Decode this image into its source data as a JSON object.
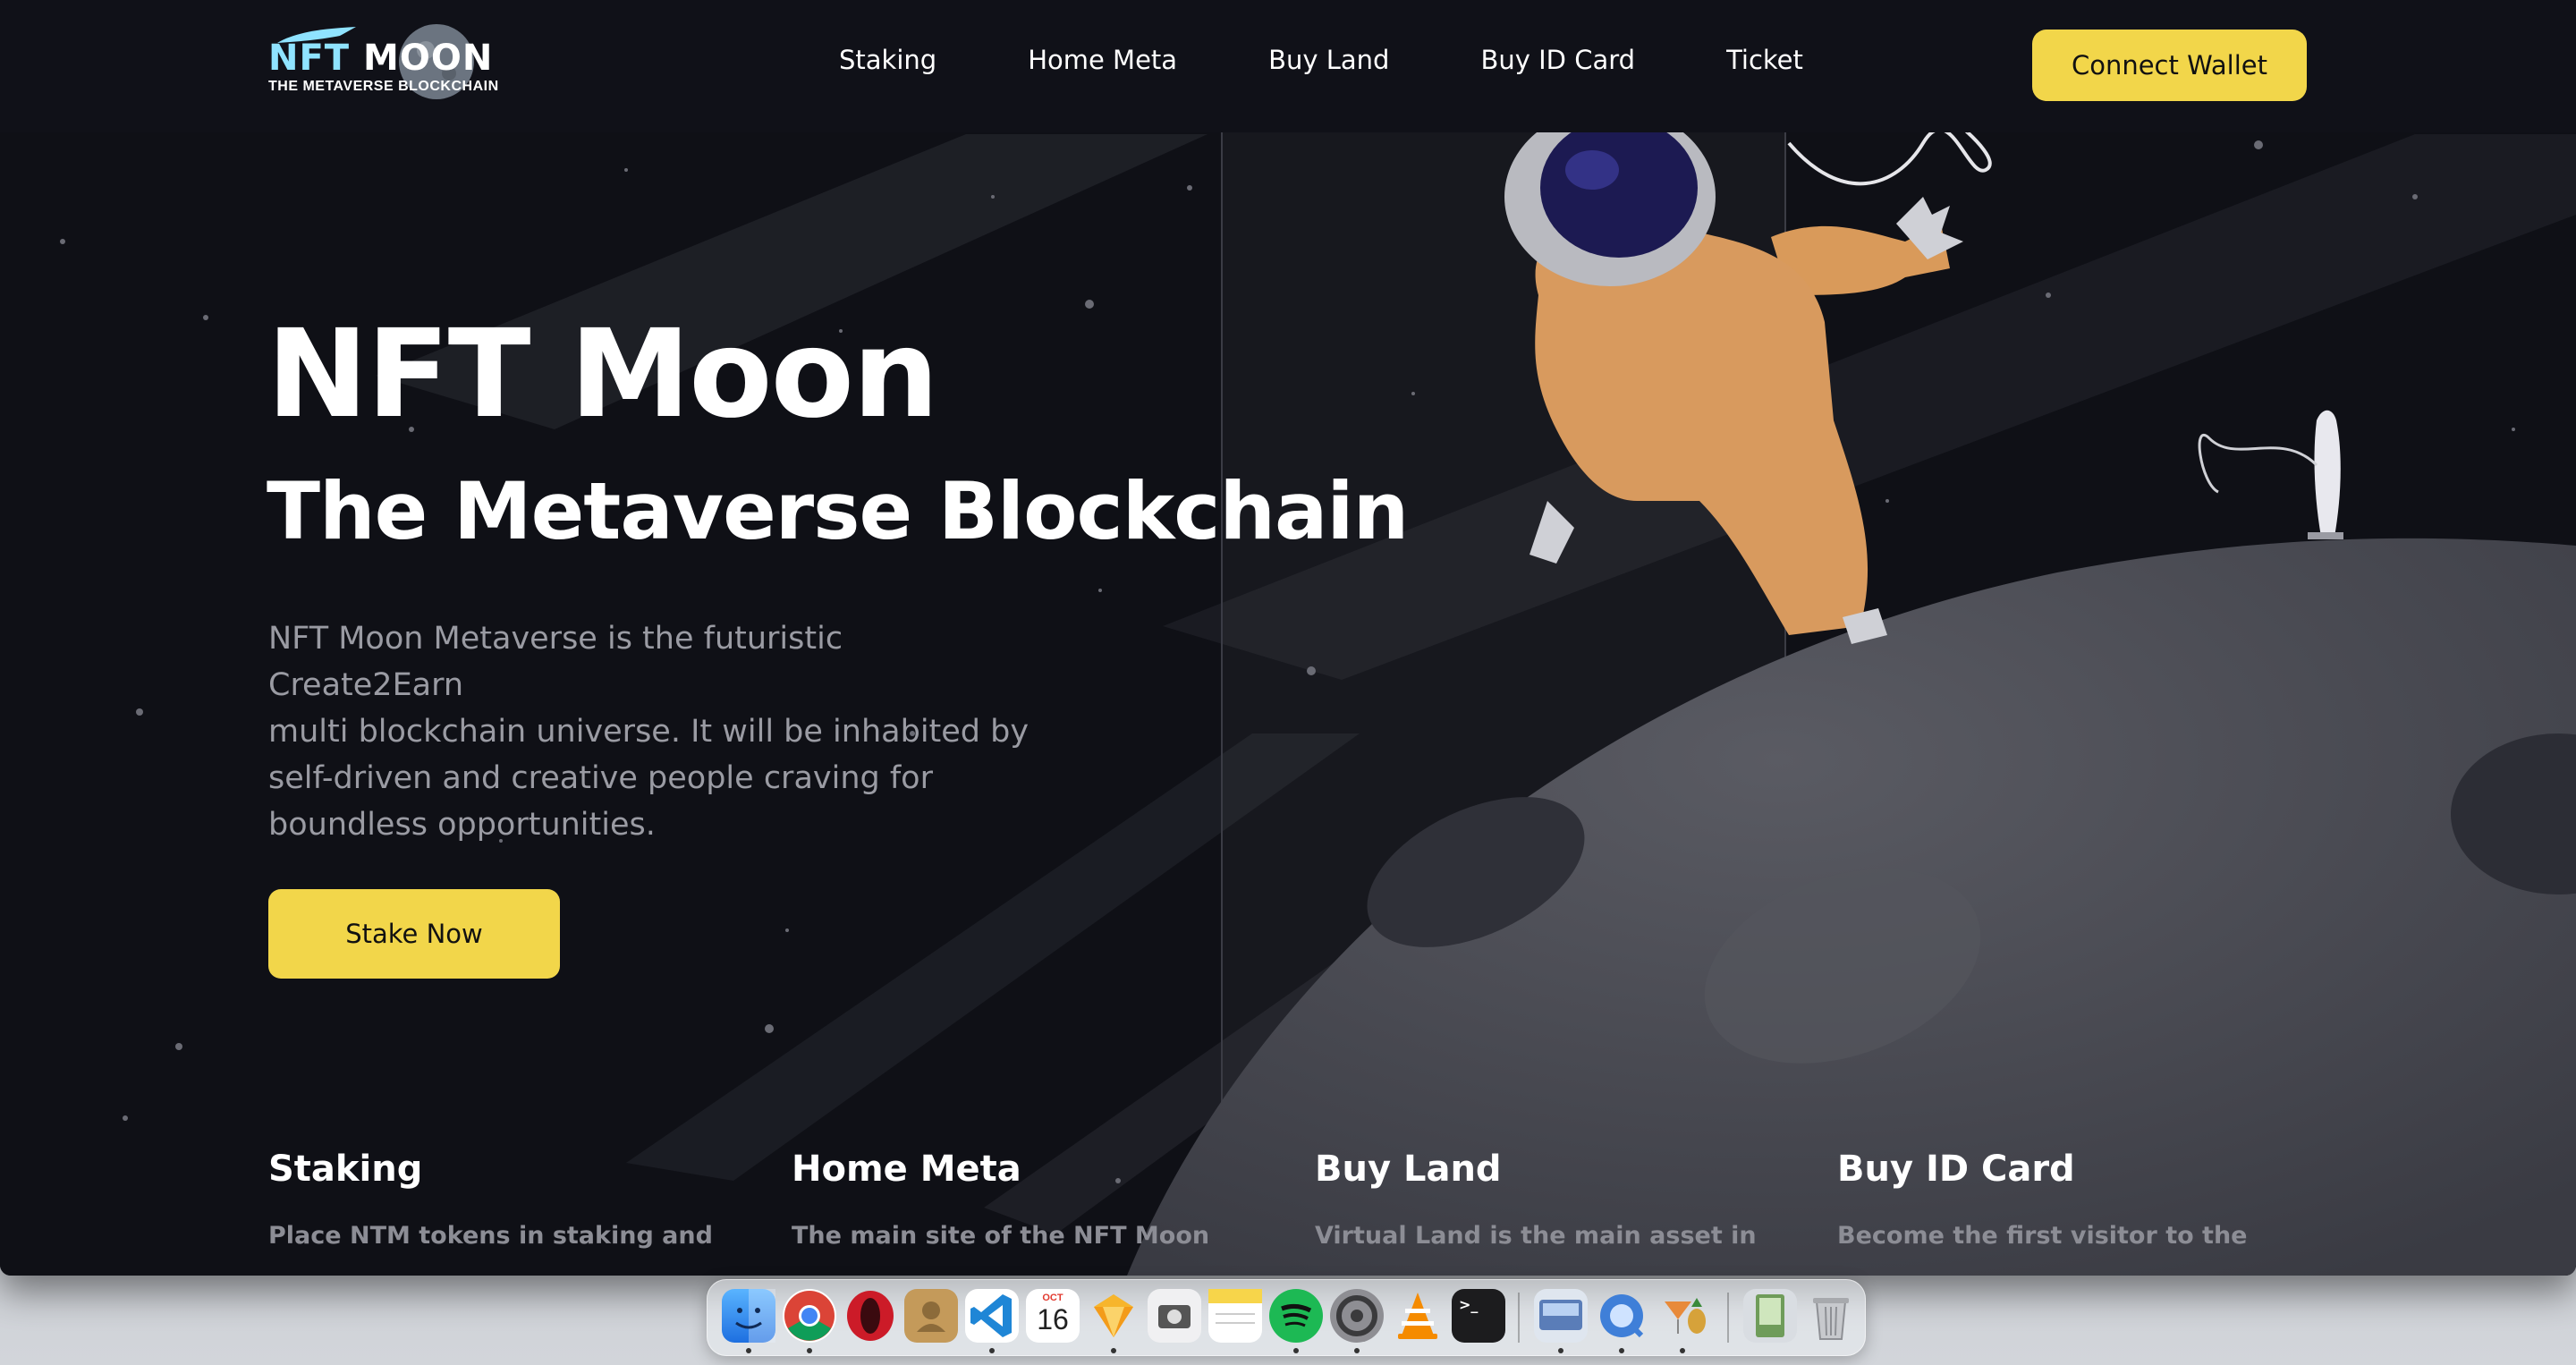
{
  "brand": {
    "logo_title_part1": "NFT",
    "logo_title_part2": "MOON",
    "logo_subtitle": "THE METAVERSE BLOCKCHAIN"
  },
  "nav": {
    "links": [
      "Staking",
      "Home Meta",
      "Buy Land",
      "Buy ID Card",
      "Ticket"
    ],
    "connect_wallet_label": "Connect Wallet"
  },
  "hero": {
    "title": "NFT Moon",
    "subtitle": "The Metaverse Blockchain",
    "description_lines": [
      "NFT Moon Metaverse is the futuristic Create2Earn",
      "multi blockchain universe. It will be inhabited by",
      "self-driven and creative people craving for",
      "boundless opportunities."
    ],
    "cta_label": "Stake Now"
  },
  "cards": [
    {
      "title": "Staking",
      "desc_line1": "Place NTM tokens in staking and",
      "desc_line2": ""
    },
    {
      "title": "Home Meta",
      "desc_line1": "The main site of the NFT Moon",
      "desc_line2": ""
    },
    {
      "title": "Buy Land",
      "desc_line1": "Virtual Land is the main asset in",
      "desc_line2": ""
    },
    {
      "title": "Buy ID Card",
      "desc_line1": "Become the first visitor to the",
      "desc_line2": ""
    }
  ],
  "dock": {
    "calendar_month": "OCT",
    "calendar_day": "16",
    "apps": [
      "finder-icon",
      "chrome-icon",
      "opera-icon",
      "contacts-icon",
      "vscode-icon",
      "calendar-icon",
      "sketch-icon",
      "screenshot-icon",
      "notes-icon",
      "spotify-icon",
      "system-preferences-icon",
      "vlc-icon",
      "terminal-icon",
      "preview-icon",
      "quicktime-icon",
      "cocktail-icon",
      "downloads-icon",
      "trash-icon"
    ]
  },
  "colors": {
    "accent": "#f2d64a",
    "background": "#0f1016",
    "muted_text": "#9a9ba3"
  }
}
